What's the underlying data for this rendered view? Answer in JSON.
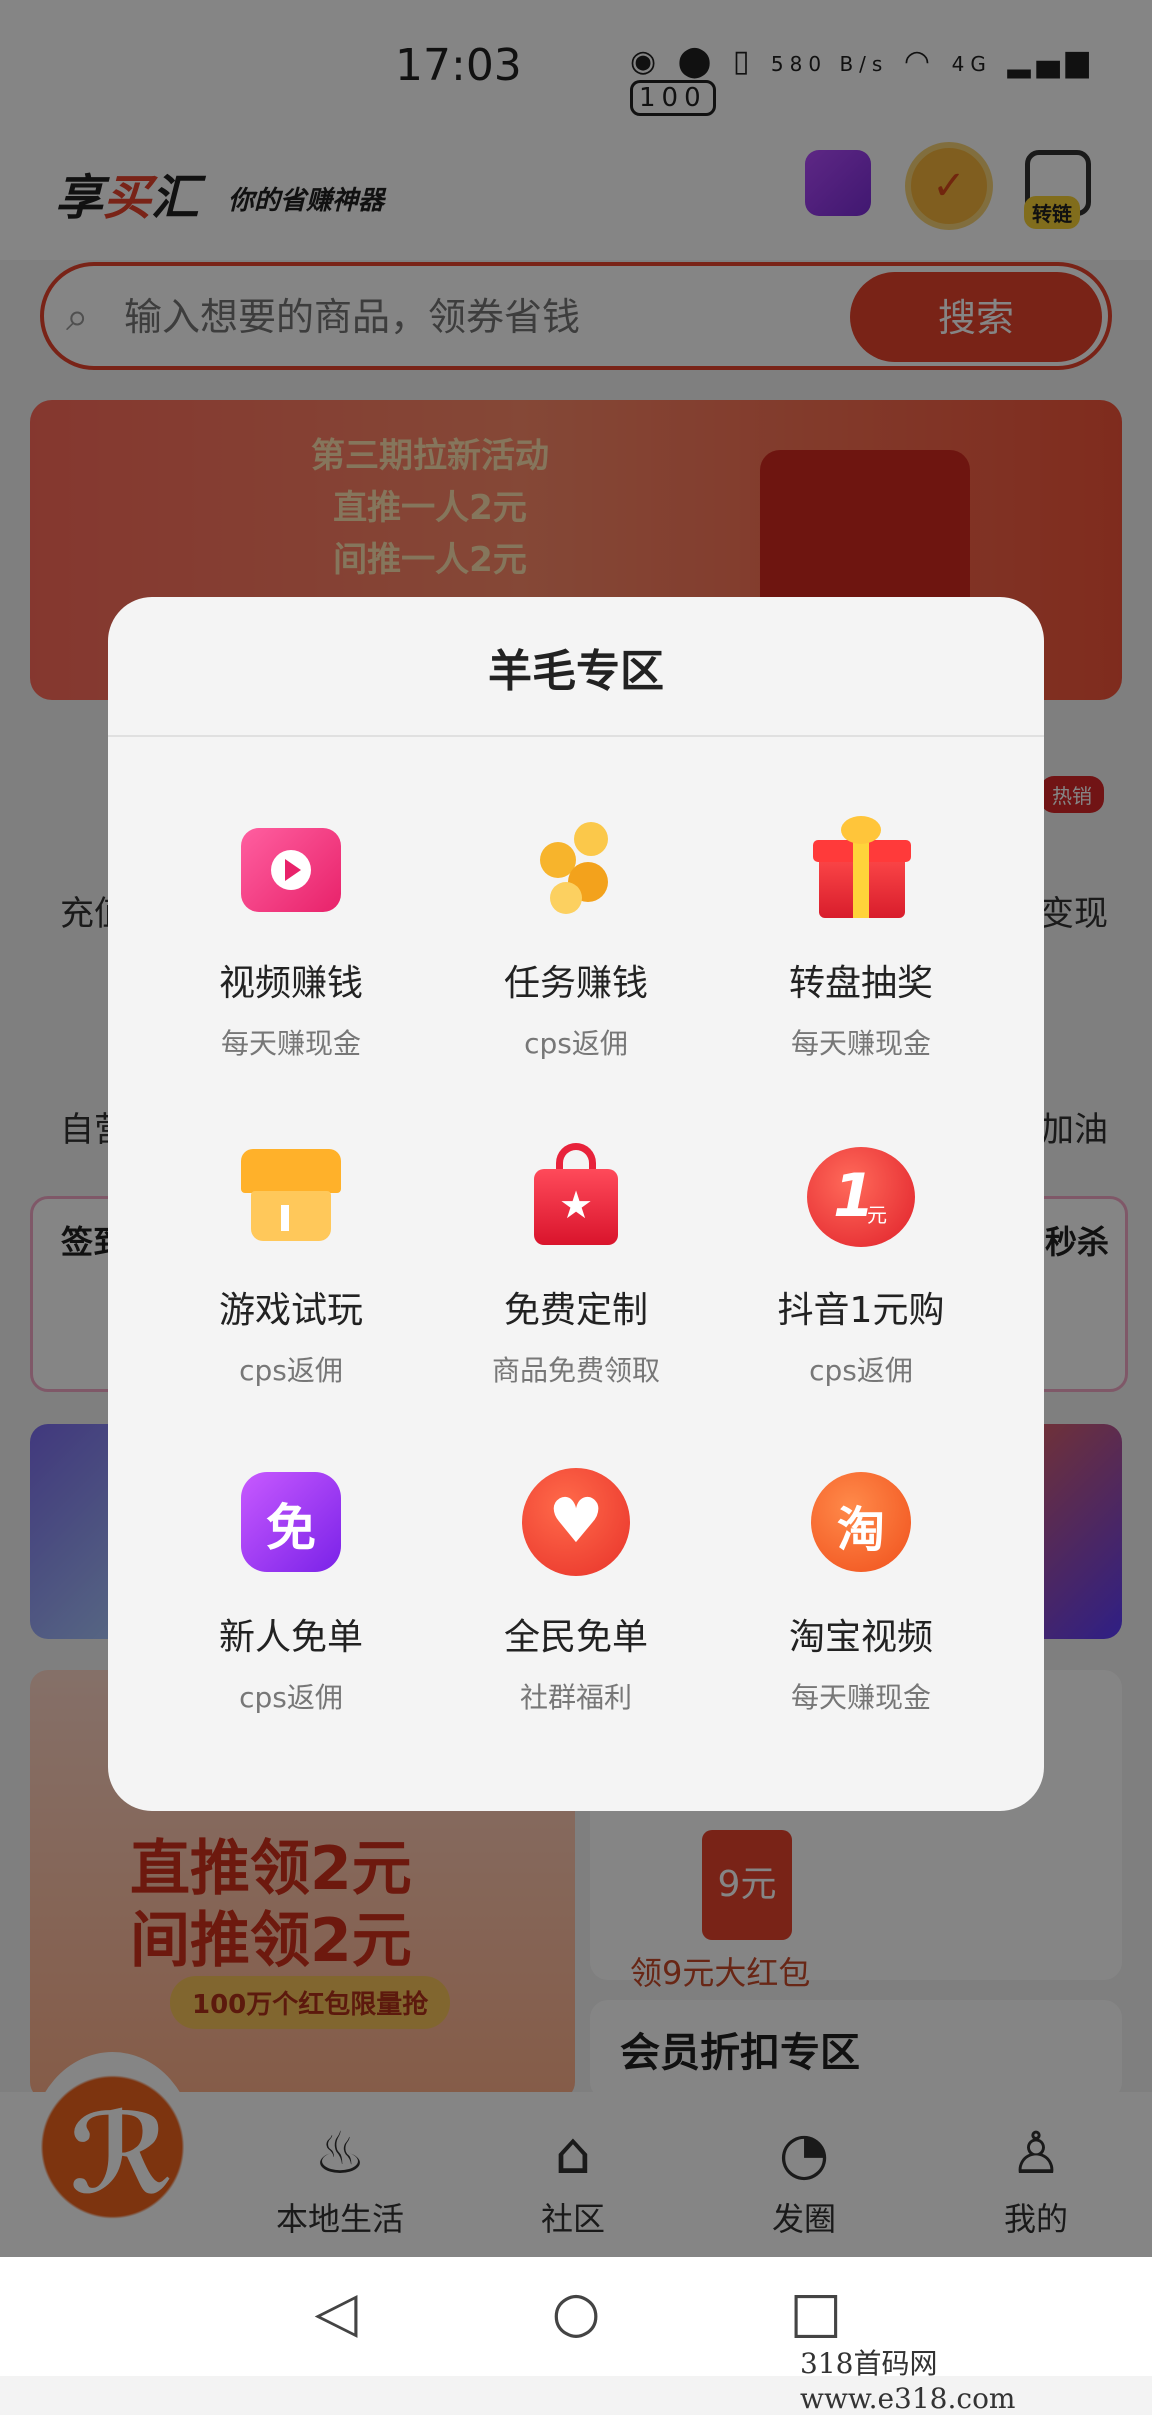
{
  "status_bar": {
    "time": "17:03",
    "net_speed": "580 B/s",
    "signal": "4G",
    "battery": "100"
  },
  "header": {
    "logo_part1": "享",
    "logo_part2": "买",
    "logo_part3": "汇",
    "slogan": "你的省赚神器",
    "convert_link_tag": "转链"
  },
  "search": {
    "placeholder": "输入想要的商品，领券省钱",
    "button_label": "搜索"
  },
  "banner": {
    "line1": "第三期拉新活动",
    "line2": "直推一人2元",
    "line3": "间推一人2元",
    "badge": "热销"
  },
  "background_labels": {
    "left1": "充值",
    "right1": "变现",
    "left2": "自营",
    "right2": "加油",
    "left_card": "签到",
    "right_card": "秒杀",
    "promo_line1": "直推领2元",
    "promo_line2": "间推领2元",
    "promo_sub": "100万个红包限量抢",
    "coupon": "领9元大红包",
    "coupon_amount": "9元",
    "member_title": "会员折扣专区"
  },
  "modal": {
    "title": "羊毛专区",
    "items": [
      {
        "name": "视频赚钱",
        "desc": "每天赚现金",
        "icon": "tv-play-icon"
      },
      {
        "name": "任务赚钱",
        "desc": "cps返佣",
        "icon": "gold-nugget-icon"
      },
      {
        "name": "转盘抽奖",
        "desc": "每天赚现金",
        "icon": "gift-box-icon"
      },
      {
        "name": "游戏试玩",
        "desc": "cps返佣",
        "icon": "shop-awning-icon"
      },
      {
        "name": "免费定制",
        "desc": "商品免费领取",
        "icon": "shopping-bag-star-icon"
      },
      {
        "name": "抖音1元购",
        "desc": "cps返佣",
        "icon": "one-yuan-coin-icon"
      },
      {
        "name": "新人免单",
        "desc": "cps返佣",
        "icon": "free-badge-icon"
      },
      {
        "name": "全民免单",
        "desc": "社群福利",
        "icon": "heart-icon"
      },
      {
        "name": "淘宝视频",
        "desc": "每天赚现金",
        "icon": "taobao-icon"
      }
    ],
    "icon_glyphs": {
      "free": "免",
      "taobao": "淘",
      "one": "1",
      "yuan": "元"
    }
  },
  "bottom_nav": {
    "items": [
      {
        "label": "本地生活",
        "icon": "fire-icon"
      },
      {
        "label": "社区",
        "icon": "graduation-cap-icon"
      },
      {
        "label": "发圈",
        "icon": "circle-play-icon"
      },
      {
        "label": "我的",
        "icon": "person-icon"
      }
    ]
  },
  "watermark": "318首码网　www.e318.com",
  "colors": {
    "brand_red": "#e8432c",
    "accent_orange": "#f0641e"
  }
}
